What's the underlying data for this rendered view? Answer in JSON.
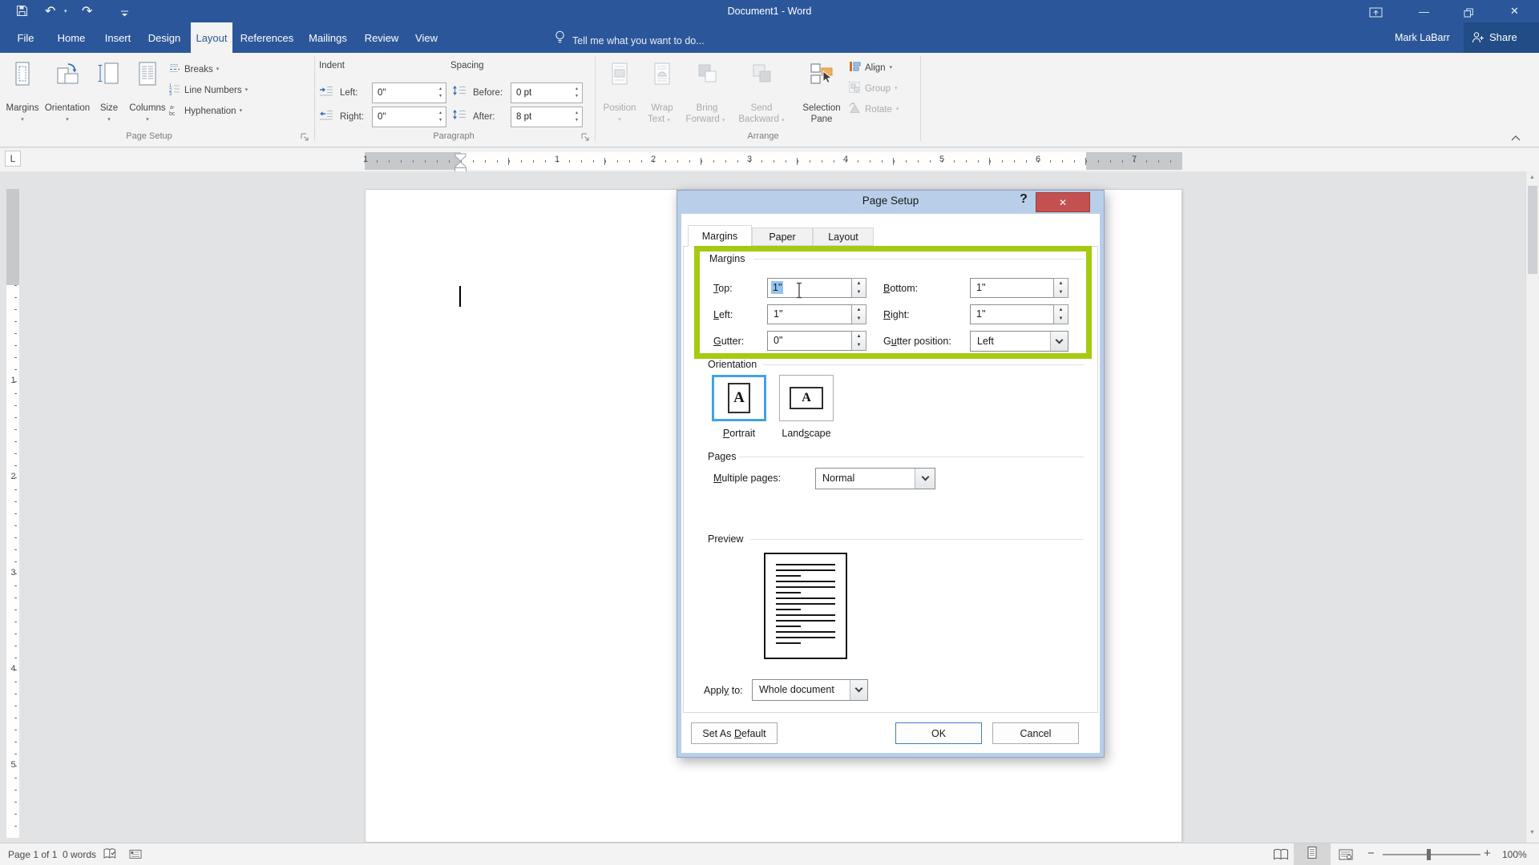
{
  "icons": {
    "dropdown": "▾",
    "spin_up": "▲",
    "spin_down": "▼",
    "undo": "↶",
    "redo": "↷",
    "close": "✕",
    "minimize": "—",
    "help": "?",
    "dialog_close": "✕",
    "zoom_out": "−",
    "zoom_in": "+",
    "tab_selector": "L"
  },
  "titlebar": {
    "title": "Document1 - Word"
  },
  "tabs": {
    "items": [
      {
        "label": "File"
      },
      {
        "label": "Home"
      },
      {
        "label": "Insert"
      },
      {
        "label": "Design"
      },
      {
        "label": "Layout"
      },
      {
        "label": "References"
      },
      {
        "label": "Mailings"
      },
      {
        "label": "Review"
      },
      {
        "label": "View"
      }
    ]
  },
  "tellme": {
    "text": "Tell me what you want to do..."
  },
  "account": {
    "name": "Mark LaBarr",
    "share": "Share"
  },
  "ribbon": {
    "page_setup": {
      "group": "Page Setup",
      "margins": "Margins",
      "orientation": "Orientation",
      "size": "Size",
      "columns": "Columns",
      "breaks": "Breaks",
      "line_numbers": "Line Numbers",
      "hyphenation": "Hyphenation"
    },
    "paragraph": {
      "group": "Paragraph",
      "indent": "Indent",
      "spacing": "Spacing",
      "left": "Left:",
      "left_value": "0\"",
      "right": "Right:",
      "right_value": "0\"",
      "before": "Before:",
      "before_value": "0 pt",
      "after": "After:",
      "after_value": "8 pt"
    },
    "arrange": {
      "group": "Arrange",
      "position": "Position",
      "wrap1": "Wrap",
      "wrap2": "Text",
      "bring1": "Bring",
      "bring2": "Forward",
      "send1": "Send",
      "send2": "Backward",
      "sel1": "Selection",
      "sel2": "Pane",
      "align": "Align",
      "group_btn": "Group",
      "rotate": "Rotate"
    }
  },
  "ruler": {
    "left_margin": "1",
    "inches": [
      "1",
      "2",
      "3",
      "4",
      "5",
      "6"
    ],
    "right_margin": "7",
    "vertical": [
      "1",
      "2",
      "3",
      "4",
      "5"
    ]
  },
  "dialog": {
    "title": "Page Setup",
    "tabs": [
      {
        "label": "Margins"
      },
      {
        "label": "Paper"
      },
      {
        "label": "Layout"
      }
    ],
    "margins": {
      "legend": "Margins",
      "top": "<u>T</u>op:",
      "top_value": "1\"",
      "bottom": "<u>B</u>ottom:",
      "bottom_value": "1\"",
      "left": "<u>L</u>eft:",
      "left_value": "1\"",
      "right": "<u>R</u>ight:",
      "right_value": "1\"",
      "gutter": "<u>G</u>utter:",
      "gutter_value": "0\"",
      "gutter_position": "G<u>u</u>tter position:",
      "gutter_position_value": "Left"
    },
    "orientation": {
      "legend": "Orientation",
      "portrait": "<u>P</u>ortrait",
      "landscape": "Land<u>s</u>cape"
    },
    "pages": {
      "legend": "Pages",
      "multiple": "<u>M</u>ultiple pages:",
      "multiple_value": "Normal"
    },
    "preview": {
      "legend": "Preview"
    },
    "apply": {
      "label": "Appl<u>y</u> to:",
      "value": "Whole document"
    },
    "buttons": {
      "set_default": "Set As <u>D</u>efault",
      "ok": "OK",
      "cancel": "Cancel"
    }
  },
  "status": {
    "page": "Page 1 of 1",
    "words": "0 words",
    "zoom": "100%"
  },
  "colors": {
    "accent_blue": "#2b579a",
    "highlight_green": "#a4cb10",
    "selection_blue": "#92c4ef",
    "close_red": "#c3514f",
    "dialog_frame": "#b9cfe9"
  }
}
